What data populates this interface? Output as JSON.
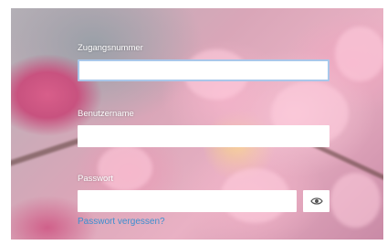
{
  "login": {
    "account_number_label": "Zugangsnummer",
    "account_number_value": "",
    "username_label": "Benutzername",
    "username_value": "",
    "password_label": "Passwort",
    "password_value": "",
    "forgot_password_link": "Passwort vergessen?",
    "show_password_icon": "eye-icon"
  },
  "colors": {
    "link": "#3a8fd0",
    "active_border": "#a9c7ea",
    "label_text": "#ffffff"
  }
}
